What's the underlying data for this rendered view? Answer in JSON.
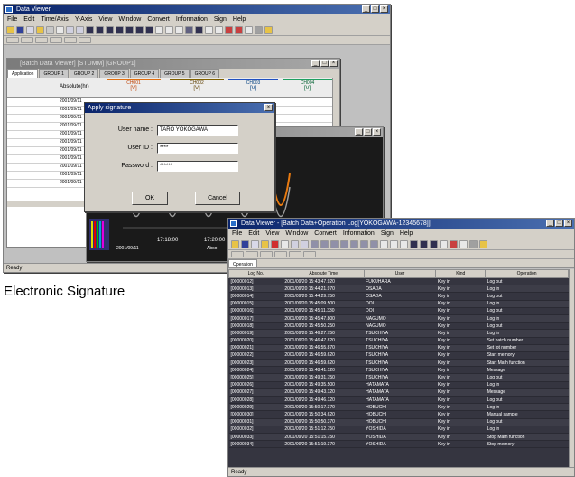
{
  "dataviewer": {
    "title": "Data Viewer",
    "menus": [
      "File",
      "Edit",
      "Time/Axis",
      "Y-Axis",
      "View",
      "Window",
      "Convert",
      "Information",
      "Sign",
      "Help"
    ],
    "inner_title": "[Batch Data Viewer] [STUMM] [GROUP1]",
    "group_tabs": [
      "Application",
      "GROUP 1",
      "GROUP 2",
      "GROUP 3",
      "GROUP 4",
      "GROUP 5",
      "GROUP 6"
    ],
    "col_header": "Absolute(hr)",
    "channels": [
      {
        "name": "CH001",
        "unit": "[V]"
      },
      {
        "name": "CH002",
        "unit": "[V]"
      },
      {
        "name": "CH003",
        "unit": "[V]"
      },
      {
        "name": "CH004",
        "unit": "[V]"
      }
    ],
    "row_values": [
      "2001/09/11",
      "2001/09/11",
      "2001/09/11",
      "2001/09/11",
      "2001/09/11",
      "2001/09/11",
      "2001/09/11",
      "2001/09/11",
      "2001/09/11",
      "2001/09/11",
      "2001/09/11"
    ],
    "status": "Ready"
  },
  "chart_window": {
    "time_labels": [
      "17:18:00",
      "17:20:00"
    ],
    "date_label": "2001/09/11",
    "abs_label": "Abso"
  },
  "dialog": {
    "title": "Apply signature",
    "user_name_label": "User name :",
    "user_name_value": "TARO YOKOGAWA",
    "user_id_label": "User ID :",
    "user_id_value": "****",
    "password_label": "Password :",
    "password_value": "******",
    "ok": "OK",
    "cancel": "Cancel"
  },
  "caption": "Electronic Signature",
  "oplog": {
    "title": "Data Viewer - [Batch Data+Operation Log[YOKOGAWA-12345678]]",
    "menus": [
      "File",
      "Edit",
      "View",
      "Window",
      "Convert",
      "Information",
      "Sign",
      "Help"
    ],
    "tab": "Operation",
    "status": "Ready",
    "columns": [
      "Log No.",
      "Absolute Time",
      "User",
      "Kind",
      "Operation"
    ],
    "rows": [
      [
        "[00000012]",
        "2001/09/20 15:43:47.920",
        "FUKUHARA",
        "Key in",
        "Log out"
      ],
      [
        "[00000013]",
        "2001/09/20 15:44:21.970",
        "OSADA",
        "Key in",
        "Log in"
      ],
      [
        "[00000014]",
        "2001/09/20 15:44:29.750",
        "OSADA",
        "Key in",
        "Log out"
      ],
      [
        "[00000015]",
        "2001/09/20 15:45:09.500",
        "DOI",
        "Key in",
        "Log in"
      ],
      [
        "[00000016]",
        "2001/09/20 15:45:11.330",
        "DOI",
        "Key in",
        "Log out"
      ],
      [
        "[00000017]",
        "2001/09/20 15:45:47.800",
        "NAGUMO",
        "Key in",
        "Log in"
      ],
      [
        "[00000018]",
        "2001/09/20 15:45:50.250",
        "NAGUMO",
        "Key in",
        "Log out"
      ],
      [
        "[00000019]",
        "2001/09/20 15:46:27.750",
        "TSUCHIYA",
        "Key in",
        "Log in"
      ],
      [
        "[00000020]",
        "2001/09/20 15:46:47.820",
        "TSUCHIYA",
        "Key in",
        "Set batch number"
      ],
      [
        "[00000021]",
        "2001/09/20 15:46:55.870",
        "TSUCHIYA",
        "Key in",
        "Set lot number"
      ],
      [
        "[00000022]",
        "2001/09/20 15:46:59.620",
        "TSUCHIYA",
        "Key in",
        "Start memory"
      ],
      [
        "[00000023]",
        "2001/09/20 15:46:59.620",
        "TSUCHIYA",
        "Key in",
        "Start Math function"
      ],
      [
        "[00000024]",
        "2001/09/20 15:48:41.120",
        "TSUCHIYA",
        "Key in",
        "Message"
      ],
      [
        "[00000025]",
        "2001/09/20 15:49:31.750",
        "TSUCHIYA",
        "Key in",
        "Log out"
      ],
      [
        "[00000026]",
        "2001/09/20 15:49:35.500",
        "HATAMATA",
        "Key in",
        "Log in"
      ],
      [
        "[00000027]",
        "2001/09/20 15:49:43.120",
        "HATAMATA",
        "Key in",
        "Message"
      ],
      [
        "[00000028]",
        "2001/09/20 15:49:46.120",
        "HATAMATA",
        "Key in",
        "Log out"
      ],
      [
        "[00000029]",
        "2001/09/20 15:50:17.370",
        "HOBUCHI",
        "Key in",
        "Log in"
      ],
      [
        "[00000030]",
        "2001/09/20 15:50:34.620",
        "HOBUCHI",
        "Key in",
        "Manual sample"
      ],
      [
        "[00000031]",
        "2001/09/20 15:50:50.370",
        "HOBUCHI",
        "Key in",
        "Log out"
      ],
      [
        "[00000032]",
        "2001/09/20 15:51:12.750",
        "YOSHIDA",
        "Key in",
        "Log in"
      ],
      [
        "[00000033]",
        "2001/09/20 15:51:15.750",
        "YOSHIDA",
        "Key in",
        "Stop Math function"
      ],
      [
        "[00000034]",
        "2001/09/20 15:51:19.370",
        "YOSHIDA",
        "Key in",
        "Stop memory"
      ]
    ]
  }
}
